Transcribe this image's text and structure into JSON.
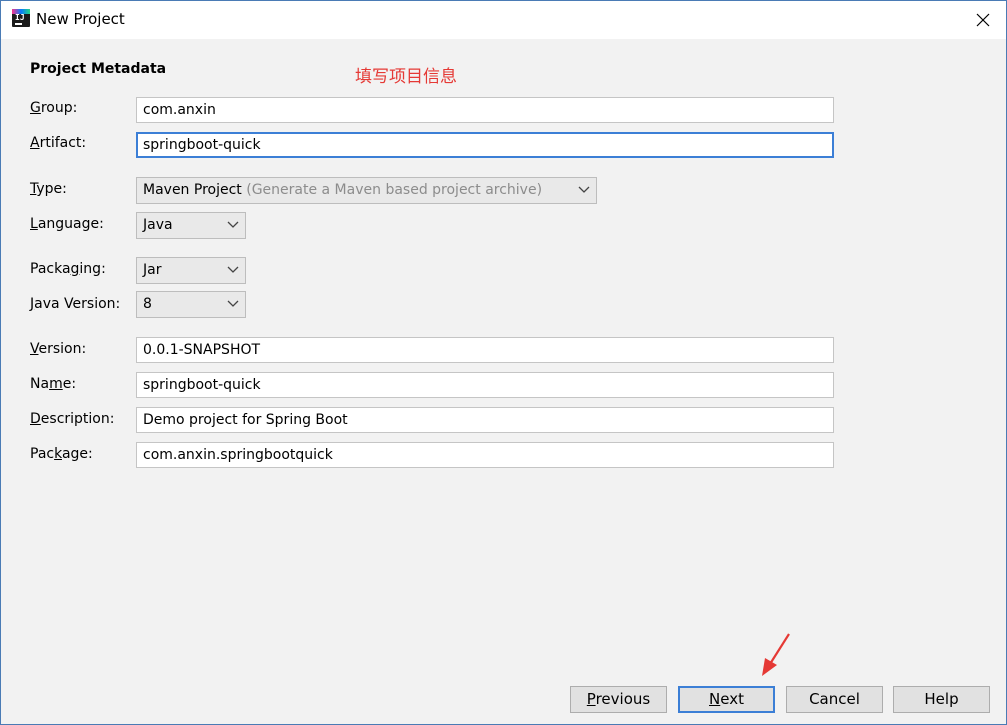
{
  "window": {
    "title": "New Project",
    "icon": "intellij-idea-icon",
    "close_icon": "close-icon"
  },
  "section": {
    "title": "Project Metadata",
    "annotation": "填写项目信息"
  },
  "fields": {
    "group": {
      "label_pre": "",
      "label_u": "G",
      "label_post": "roup:",
      "value": "com.anxin"
    },
    "artifact": {
      "label_pre": "",
      "label_u": "A",
      "label_post": "rtifact:",
      "value": "springboot-quick"
    },
    "type": {
      "label_pre": "",
      "label_u": "T",
      "label_post": "ype:",
      "value": "Maven Project",
      "hint": "(Generate a Maven based project archive)"
    },
    "language": {
      "label_pre": "",
      "label_u": "L",
      "label_post": "anguage:",
      "value": "Java"
    },
    "packaging": {
      "label_pre": "Packa",
      "label_u": "g",
      "label_post": "ing:",
      "value": "Jar"
    },
    "java_version": {
      "label_pre": "",
      "label_u": "J",
      "label_post": "ava Version:",
      "value": "8"
    },
    "version": {
      "label_pre": "",
      "label_u": "V",
      "label_post": "ersion:",
      "value": "0.0.1-SNAPSHOT"
    },
    "name": {
      "label_pre": "Na",
      "label_u": "m",
      "label_post": "e:",
      "value": "springboot-quick"
    },
    "description": {
      "label_pre": "",
      "label_u": "D",
      "label_post": "escription:",
      "value": "Demo project for Spring Boot"
    },
    "package": {
      "label_pre": "Pac",
      "label_u": "k",
      "label_post": "age:",
      "value": "com.anxin.springbootquick"
    }
  },
  "buttons": {
    "previous": {
      "pre": "",
      "u": "P",
      "post": "revious"
    },
    "next": {
      "pre": "",
      "u": "N",
      "post": "ext"
    },
    "cancel": "Cancel",
    "help": "Help"
  },
  "colors": {
    "accent": "#3c7fd6",
    "annotation": "#e53935",
    "arrow": "#e53935"
  }
}
